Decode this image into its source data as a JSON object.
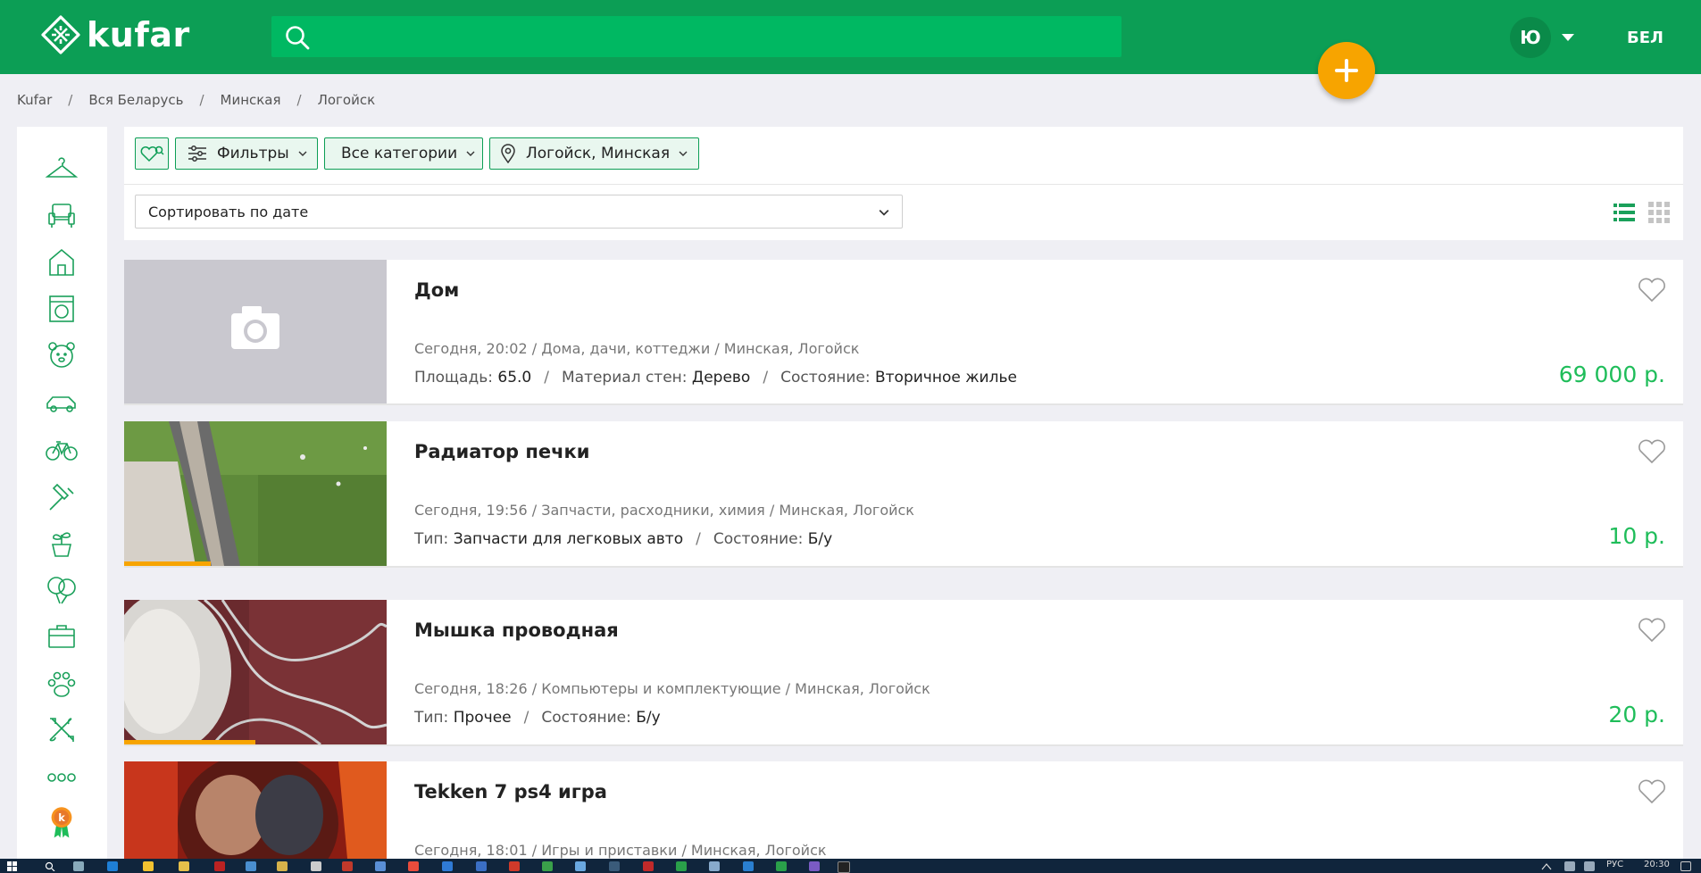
{
  "header": {
    "logo_text": "kufar",
    "search_placeholder": "",
    "avatar_initial": "Ю",
    "lang_label": "БЕЛ",
    "colors": {
      "header_bg": "#0c9e55",
      "search_bg": "#00b862",
      "accent_orange": "#f7a400",
      "price_green": "#1fbd5a"
    }
  },
  "breadcrumb": [
    "Kufar",
    "Вся Беларусь",
    "Минская",
    "Логойск"
  ],
  "sidebar": {
    "categories": [
      "clothes-hanger-icon",
      "armchair-icon",
      "house-icon",
      "washing-machine-icon",
      "teddy-bear-icon",
      "car-icon",
      "bicycle-icon",
      "hammer-icon",
      "plant-pot-icon",
      "balloons-icon",
      "briefcase-icon",
      "paw-icon",
      "tools-icon",
      "more-dots-icon",
      "kufar-badge-icon"
    ],
    "badge_letter": "k"
  },
  "filters": {
    "filters_label": "Фильтры",
    "categories_label": "Все категории",
    "location_label": "Логойск, Минская",
    "sort_label": "Сортировать по дате"
  },
  "listings": [
    {
      "title": "Дом",
      "meta": "Сегодня, 20:02 / Дома, дачи, коттеджи / Минская, Логойск",
      "params": [
        {
          "k": "Площадь:",
          "v": "65.0"
        },
        {
          "k": "Материал стен:",
          "v": "Дерево"
        },
        {
          "k": "Состояние:",
          "v": "Вторичное жилье"
        }
      ],
      "price": "69 000 р.",
      "image": "placeholder-camera"
    },
    {
      "title": "Радиатор печки",
      "meta": "Сегодня, 19:56 / Запчасти, расходники, химия / Минская, Логойск",
      "params": [
        {
          "k": "Тип:",
          "v": "Запчасти для легковых авто"
        },
        {
          "k": "Состояние:",
          "v": "Б/у"
        }
      ],
      "price": "10 р.",
      "image_progress": 0.33
    },
    {
      "title": "Мышка проводная",
      "meta": "Сегодня, 18:26 / Компьютеры и комплектующие / Минская, Логойск",
      "params": [
        {
          "k": "Тип:",
          "v": "Прочее"
        },
        {
          "k": "Состояние:",
          "v": "Б/у"
        }
      ],
      "price": "20 р.",
      "image_progress": 0.5
    },
    {
      "title": "Tekken 7 ps4 игра",
      "meta": "Сегодня, 18:01 / Игры и приставки / Минская, Логойск",
      "params": [],
      "price": ""
    }
  ],
  "taskbar": {
    "lang": "РУС",
    "time": "20:30"
  }
}
